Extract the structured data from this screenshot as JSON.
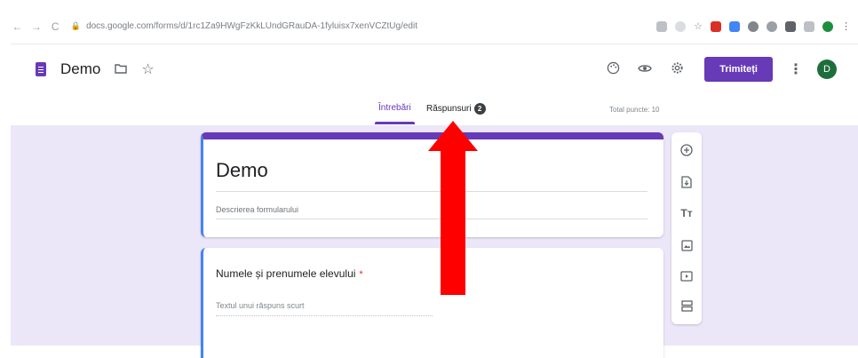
{
  "browser": {
    "url": "docs.google.com/forms/d/1rc1Za9HWgFzKkLUndGRauDA-1fyluisx7xenVCZtUg/edit",
    "nav_icons": [
      "back-icon",
      "forward-icon",
      "reload-icon"
    ],
    "extension_colors": [
      "#9aa0a6",
      "#9aa0a6",
      "#9aa0a6",
      "#d93025",
      "#4285f4",
      "#5f6368",
      "#5f6368",
      "#5f6368",
      "#9aa0a6",
      "#1e8e3e"
    ]
  },
  "header": {
    "doc_title": "Demo",
    "send_label": "Trimiteți",
    "avatar_initial": "D",
    "icons": [
      "palette-icon",
      "preview-eye-icon",
      "settings-gear-icon"
    ]
  },
  "tabs": [
    {
      "label": "Întrebări",
      "active": true
    },
    {
      "label": "Răspunsuri",
      "badge": "2",
      "active": false
    }
  ],
  "total_points": "Total puncte: 10",
  "form": {
    "title": "Demo",
    "description_placeholder": "Descrierea formularului",
    "question": {
      "title": "Numele și prenumele elevului",
      "required_mark": "*",
      "answer_placeholder": "Textul unui răspuns scurt"
    }
  },
  "sidebar_tools": [
    "add-question-icon",
    "import-questions-icon",
    "add-title-text-icon",
    "add-image-icon",
    "add-video-icon",
    "add-section-icon"
  ],
  "colors": {
    "accent": "#673ab7",
    "canvas_bg": "#ece7f8",
    "focus_border": "#4285f4",
    "arrow": "#ff0000"
  }
}
